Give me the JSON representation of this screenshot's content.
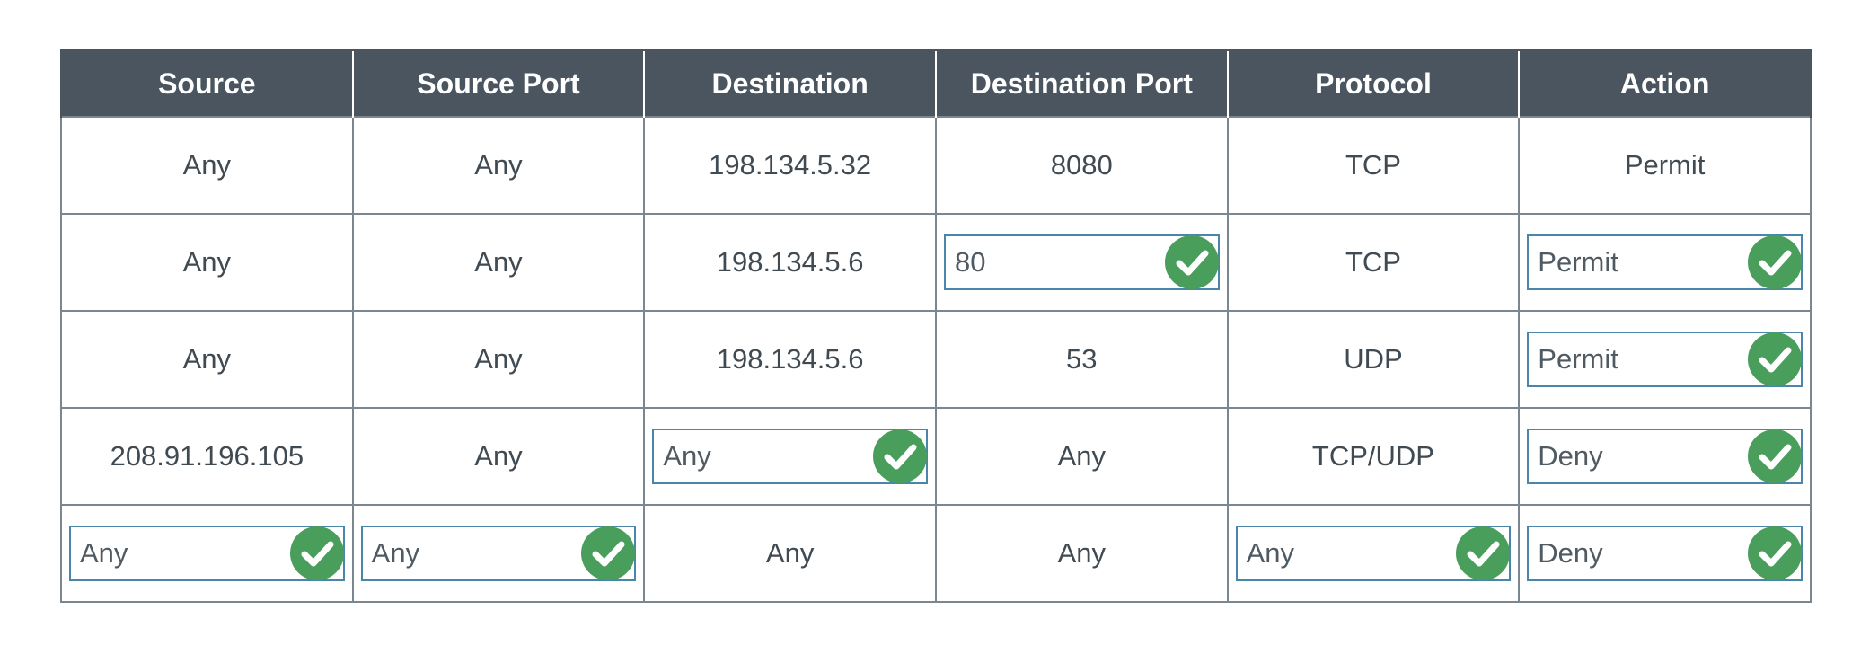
{
  "table": {
    "headers": [
      "Source",
      "Source Port",
      "Destination",
      "Destination Port",
      "Protocol",
      "Action"
    ],
    "rows": [
      {
        "source": "Any",
        "source_port": "Any",
        "destination": "198.134.5.32",
        "destination_port": "8080",
        "protocol": "TCP",
        "action": "Permit"
      },
      {
        "source": "Any",
        "source_port": "Any",
        "destination": "198.134.5.6",
        "destination_port": "80",
        "protocol": "TCP",
        "action": "Permit"
      },
      {
        "source": "Any",
        "source_port": "Any",
        "destination": "198.134.5.6",
        "destination_port": "53",
        "protocol": "UDP",
        "action": "Permit"
      },
      {
        "source": "208.91.196.105",
        "source_port": "Any",
        "destination": "Any",
        "destination_port": "Any",
        "protocol": "TCP/UDP",
        "action": "Deny"
      },
      {
        "source": "Any",
        "source_port": "Any",
        "destination": "Any",
        "destination_port": "Any",
        "protocol": "Any",
        "action": "Deny"
      }
    ]
  },
  "icons": {
    "correct": "check-circle-icon"
  },
  "colors": {
    "header_bg": "#4a5560",
    "header_text": "#ffffff",
    "grid_border": "#7a8690",
    "answer_border": "#4a86a8",
    "check_green": "#4a9e5c"
  }
}
